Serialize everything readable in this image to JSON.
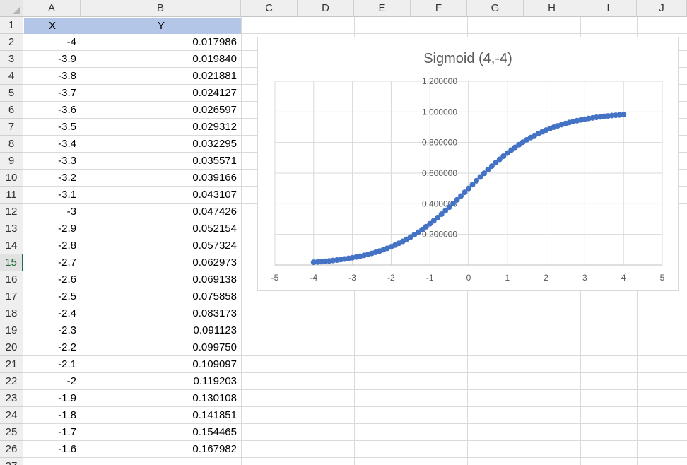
{
  "columns": [
    "A",
    "B",
    "C",
    "D",
    "E",
    "F",
    "G",
    "H",
    "I",
    "J"
  ],
  "rows": [
    "1",
    "2",
    "3",
    "4",
    "5",
    "6",
    "7",
    "8",
    "9",
    "10",
    "11",
    "12",
    "13",
    "14",
    "15",
    "16",
    "17",
    "18",
    "19",
    "20",
    "21",
    "22",
    "23",
    "24",
    "25",
    "26",
    "27"
  ],
  "active_row": "15",
  "table": {
    "header_x": "X",
    "header_y": "Y",
    "x_values": [
      "-4",
      "-3.9",
      "-3.8",
      "-3.7",
      "-3.6",
      "-3.5",
      "-3.4",
      "-3.3",
      "-3.2",
      "-3.1",
      "-3",
      "-2.9",
      "-2.8",
      "-2.7",
      "-2.6",
      "-2.5",
      "-2.4",
      "-2.3",
      "-2.2",
      "-2.1",
      "-2",
      "-1.9",
      "-1.8",
      "-1.7",
      "-1.6"
    ],
    "y_values": [
      "0.017986",
      "0.019840",
      "0.021881",
      "0.024127",
      "0.026597",
      "0.029312",
      "0.032295",
      "0.035571",
      "0.039166",
      "0.043107",
      "0.047426",
      "0.052154",
      "0.057324",
      "0.062973",
      "0.069138",
      "0.075858",
      "0.083173",
      "0.091123",
      "0.099750",
      "0.109097",
      "0.119203",
      "0.130108",
      "0.141851",
      "0.154465",
      "0.167982"
    ]
  },
  "chart_data": {
    "type": "scatter",
    "title": "Sigmoid (4,-4)",
    "xlabel": "",
    "ylabel": "",
    "xlim": [
      -5,
      5
    ],
    "ylim": [
      0,
      1.2
    ],
    "x_ticks": [
      "-5",
      "-4",
      "-3",
      "-2",
      "-1",
      "0",
      "1",
      "2",
      "3",
      "4",
      "5"
    ],
    "y_ticks": [
      "1.200000",
      "1.000000",
      "0.800000",
      "0.600000",
      "0.400000",
      "0.200000"
    ],
    "grid": true,
    "marker_color": "#4472c4",
    "series": [
      {
        "x": [
          -4,
          -3.9,
          -3.8,
          -3.7,
          -3.6,
          -3.5,
          -3.4,
          -3.3,
          -3.2,
          -3.1,
          -3,
          -2.9,
          -2.8,
          -2.7,
          -2.6,
          -2.5,
          -2.4,
          -2.3,
          -2.2,
          -2.1,
          -2,
          -1.9,
          -1.8,
          -1.7,
          -1.6,
          -1.5,
          -1.4,
          -1.3,
          -1.2,
          -1.1,
          -1,
          -0.9,
          -0.8,
          -0.7,
          -0.6,
          -0.5,
          -0.4,
          -0.3,
          -0.2,
          -0.1,
          0,
          0.1,
          0.2,
          0.3,
          0.4,
          0.5,
          0.6,
          0.7,
          0.8,
          0.9,
          1,
          1.1,
          1.2,
          1.3,
          1.4,
          1.5,
          1.6,
          1.7,
          1.8,
          1.9,
          2,
          2.1,
          2.2,
          2.3,
          2.4,
          2.5,
          2.6,
          2.7,
          2.8,
          2.9,
          3,
          3.1,
          3.2,
          3.3,
          3.4,
          3.5,
          3.6,
          3.7,
          3.8,
          3.9,
          4
        ],
        "y": [
          0.017986,
          0.01984,
          0.021881,
          0.024127,
          0.026597,
          0.029312,
          0.032295,
          0.035571,
          0.039166,
          0.043107,
          0.047426,
          0.052154,
          0.057324,
          0.062973,
          0.069138,
          0.075858,
          0.083173,
          0.091123,
          0.09975,
          0.109097,
          0.119203,
          0.130108,
          0.141851,
          0.154465,
          0.167982,
          0.182426,
          0.197816,
          0.214165,
          0.231475,
          0.24974,
          0.268941,
          0.28905,
          0.310026,
          0.331812,
          0.354344,
          0.377541,
          0.401312,
          0.425557,
          0.450166,
          0.475021,
          0.5,
          0.524979,
          0.549834,
          0.574443,
          0.598688,
          0.622459,
          0.645656,
          0.668188,
          0.689974,
          0.71095,
          0.731059,
          0.75026,
          0.768525,
          0.785835,
          0.802184,
          0.817574,
          0.832018,
          0.845535,
          0.858149,
          0.869892,
          0.880797,
          0.890903,
          0.90025,
          0.908877,
          0.916827,
          0.924142,
          0.930862,
          0.937027,
          0.942676,
          0.947846,
          0.952574,
          0.956893,
          0.960834,
          0.964429,
          0.967705,
          0.970688,
          0.973403,
          0.975873,
          0.978119,
          0.98016,
          0.982014
        ]
      }
    ]
  }
}
